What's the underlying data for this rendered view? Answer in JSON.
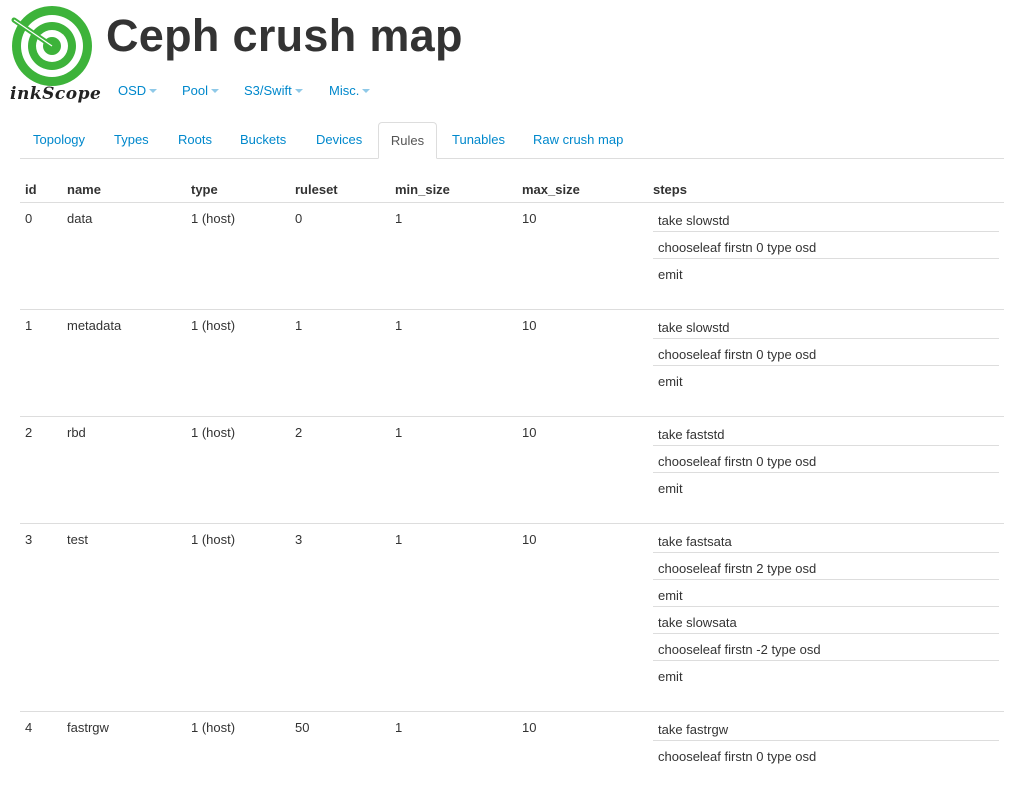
{
  "app": {
    "title": "Ceph crush map",
    "logo_text": "inkScope"
  },
  "colors": {
    "link": "#0088cc",
    "logo_green": "#3db33a",
    "border": "#dddddd"
  },
  "topnav": {
    "items": [
      {
        "label": "OSD"
      },
      {
        "label": "Pool"
      },
      {
        "label": "S3/Swift"
      },
      {
        "label": "Misc."
      }
    ]
  },
  "tabs": {
    "items": [
      {
        "label": "Topology"
      },
      {
        "label": "Types"
      },
      {
        "label": "Roots"
      },
      {
        "label": "Buckets"
      },
      {
        "label": "Devices"
      },
      {
        "label": "Rules",
        "active": true
      },
      {
        "label": "Tunables"
      },
      {
        "label": "Raw crush map"
      }
    ]
  },
  "rules_table": {
    "headers": {
      "id": "id",
      "name": "name",
      "type": "type",
      "ruleset": "ruleset",
      "min_size": "min_size",
      "max_size": "max_size",
      "steps": "steps"
    },
    "rows": [
      {
        "id": "0",
        "name": "data",
        "type": "1 (host)",
        "ruleset": "0",
        "min_size": "1",
        "max_size": "10",
        "steps": [
          "take slowstd",
          "chooseleaf firstn 0 type osd",
          "emit"
        ]
      },
      {
        "id": "1",
        "name": "metadata",
        "type": "1 (host)",
        "ruleset": "1",
        "min_size": "1",
        "max_size": "10",
        "steps": [
          "take slowstd",
          "chooseleaf firstn 0 type osd",
          "emit"
        ]
      },
      {
        "id": "2",
        "name": "rbd",
        "type": "1 (host)",
        "ruleset": "2",
        "min_size": "1",
        "max_size": "10",
        "steps": [
          "take faststd",
          "chooseleaf firstn 0 type osd",
          "emit"
        ]
      },
      {
        "id": "3",
        "name": "test",
        "type": "1 (host)",
        "ruleset": "3",
        "min_size": "1",
        "max_size": "10",
        "steps": [
          "take fastsata",
          "chooseleaf firstn 2 type osd",
          "emit",
          "take slowsata",
          "chooseleaf firstn -2 type osd",
          "emit"
        ]
      },
      {
        "id": "4",
        "name": "fastrgw",
        "type": "1 (host)",
        "ruleset": "50",
        "min_size": "1",
        "max_size": "10",
        "steps": [
          "take fastrgw",
          "chooseleaf firstn 0 type osd"
        ]
      }
    ]
  }
}
